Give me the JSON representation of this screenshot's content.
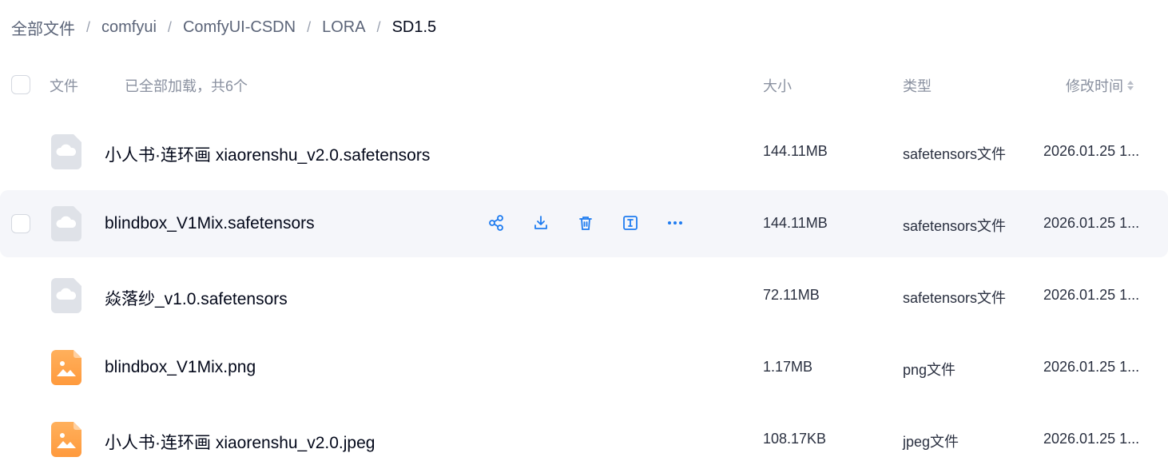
{
  "breadcrumb": [
    "全部文件",
    "comfyui",
    "ComfyUI-CSDN",
    "LORA",
    "SD1.5"
  ],
  "header": {
    "file": "文件",
    "loaded": "已全部加载，共6个",
    "size": "大小",
    "type": "类型",
    "time": "修改时间"
  },
  "rows": [
    {
      "name": "小人书·连环画 xiaorenshu_v2.0.safetensors",
      "size": "144.11MB",
      "type": "safetensors文件",
      "time": "2026.01.25 1...",
      "icon": "cloud-file-icon"
    },
    {
      "name": "blindbox_V1Mix.safetensors",
      "size": "144.11MB",
      "type": "safetensors文件",
      "time": "2026.01.25 1...",
      "icon": "cloud-file-icon"
    },
    {
      "name": "焱落纱_v1.0.safetensors",
      "size": "72.11MB",
      "type": "safetensors文件",
      "time": "2026.01.25 1...",
      "icon": "cloud-file-icon"
    },
    {
      "name": "blindbox_V1Mix.png",
      "size": "1.17MB",
      "type": "png文件",
      "time": "2026.01.25 1...",
      "icon": "image-file-icon"
    },
    {
      "name": "小人书·连环画 xiaorenshu_v2.0.jpeg",
      "size": "108.17KB",
      "type": "jpeg文件",
      "time": "2026.01.25 1...",
      "icon": "image-file-icon"
    }
  ],
  "row_actions": [
    "share-icon",
    "download-icon",
    "delete-icon",
    "rename-icon",
    "more-icon"
  ],
  "colors": {
    "accent": "#1f7cf0",
    "image_icon": "#ffa64d",
    "cloud_icon": "#dfe2e8"
  }
}
